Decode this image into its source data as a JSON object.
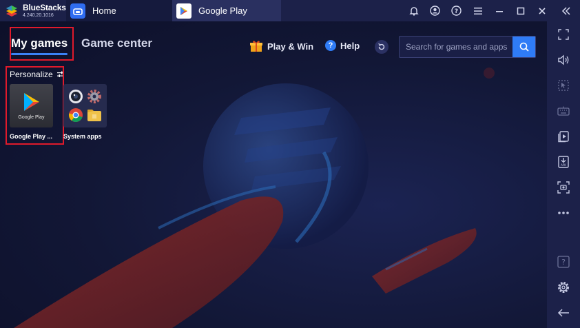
{
  "app": {
    "name": "BlueStacks",
    "version": "4.240.20.1016"
  },
  "tabs": [
    {
      "label": "Home",
      "icon": "home-icon",
      "active": true
    },
    {
      "label": "Google Play",
      "icon": "google-play-icon",
      "active": false
    }
  ],
  "titlebar_icons": [
    "bell-icon",
    "account-icon",
    "help-icon",
    "menu-icon",
    "minimize-icon",
    "maximize-icon",
    "close-icon",
    "collapse-icon"
  ],
  "nav": {
    "my_games": "My games",
    "game_center": "Game center",
    "play_win": "Play & Win",
    "help": "Help"
  },
  "search": {
    "placeholder": "Search for games and apps",
    "value": ""
  },
  "personalize": {
    "label": "Personalize"
  },
  "apps": [
    {
      "label": "Google Play ...",
      "tile_text": "Google Play",
      "icon": "google-play-logo"
    },
    {
      "label": "System apps",
      "icons": [
        "camera-icon",
        "settings-gear-icon",
        "chrome-icon",
        "folder-icon"
      ]
    }
  ],
  "sidebar_icons": [
    "fullscreen-icon",
    "volume-icon",
    "pointer-icon",
    "keyboard-icon",
    "multi-instance-icon",
    "apk-install-icon",
    "screenshot-icon",
    "more-icon",
    "help-icon",
    "settings-icon",
    "back-icon"
  ],
  "colors": {
    "accent": "#2f7cf6",
    "highlight": "#e01a2b",
    "chrome": "#1c2149",
    "background": "#0f1330"
  }
}
